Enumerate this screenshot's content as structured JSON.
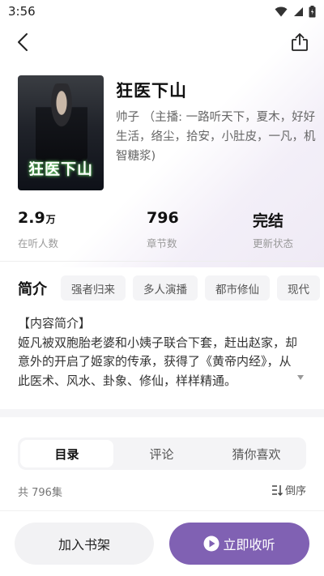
{
  "status_bar": {
    "time": "3:56",
    "icons": [
      "wifi-icon",
      "signal-icon",
      "battery-icon"
    ]
  },
  "nav": {
    "back_icon": "back-arrow-icon",
    "share_icon": "share-icon"
  },
  "book": {
    "cover_title": "狂医下山",
    "title": "狂医下山",
    "authors": "帅子 （主播: 一路听天下，夏木，好好生活，络尘，拾安，小肚皮，一凡，机智糖浆)"
  },
  "stats": {
    "listeners": {
      "value": "2.9",
      "unit": "万",
      "label": "在听人数"
    },
    "chapters": {
      "value": "796",
      "label": "章节数"
    },
    "status": {
      "value": "完结",
      "label": "更新状态"
    }
  },
  "intro": {
    "heading": "简介",
    "tags": [
      "强者归来",
      "多人演播",
      "都市修仙",
      "现代"
    ],
    "text_heading": "【内容简介】",
    "text": "姬凡被双胞胎老婆和小姨子联合下套，赶出赵家，却意外的开启了姬家的传承，获得了《黄帝内经》，从此医术、风水、卦象、修仙，样样精通。"
  },
  "tabs": [
    {
      "label": "目录",
      "active": true
    },
    {
      "label": "评论",
      "active": false
    },
    {
      "label": "猜你喜欢",
      "active": false
    }
  ],
  "episodes": {
    "count_label": "共 796集",
    "sort_label": "倒序"
  },
  "actions": {
    "add_shelf": "加入书架",
    "listen_now": "立即收听"
  },
  "colors": {
    "accent": "#8061b3",
    "tag_bg": "#f4f4f6"
  }
}
